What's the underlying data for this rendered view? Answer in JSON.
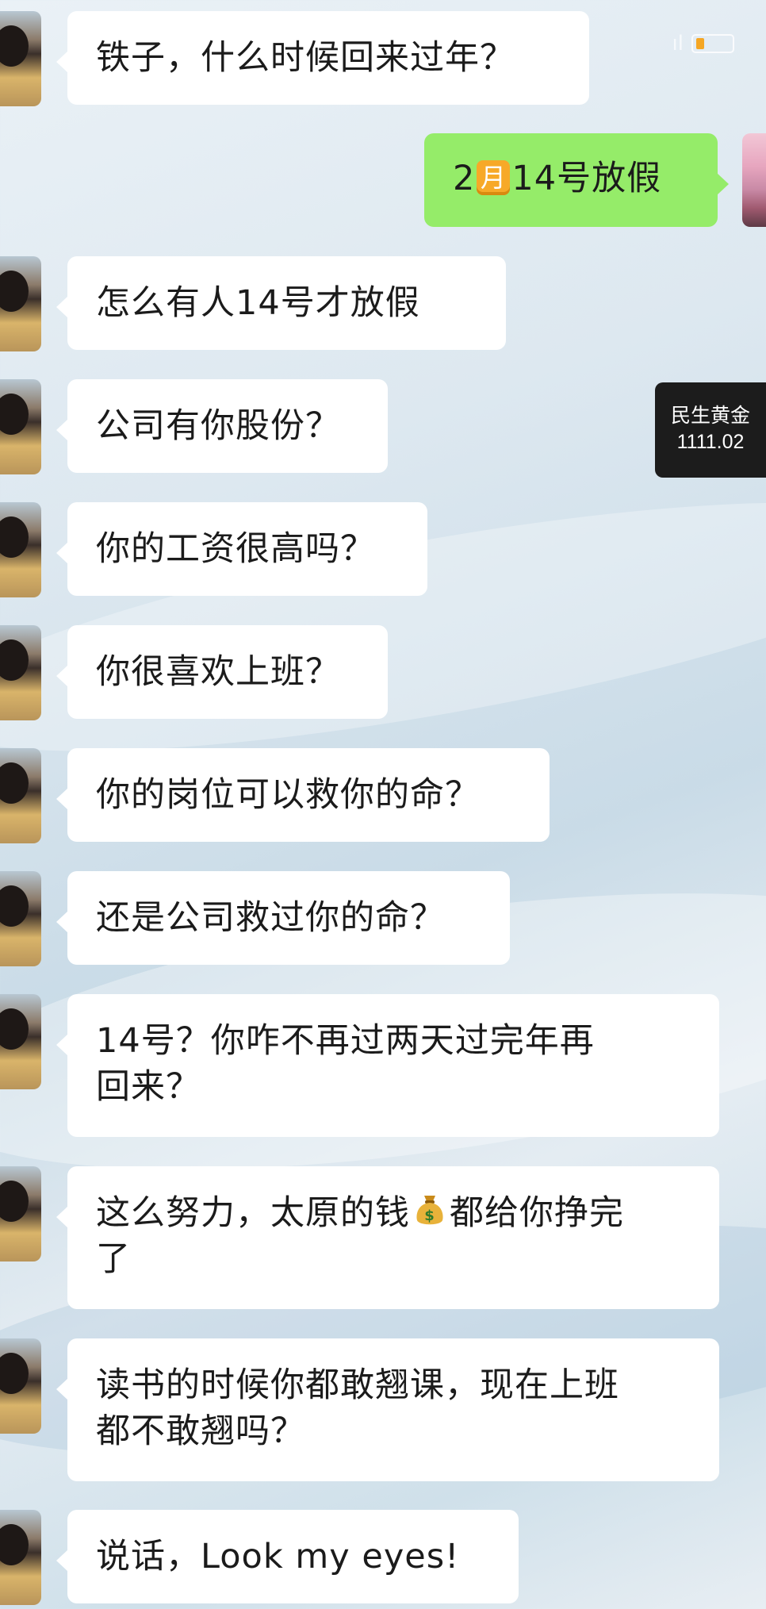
{
  "status_bar": {
    "ghost_text": "ıl",
    "battery_color": "#f5a623"
  },
  "messages": [
    {
      "sender": "friend",
      "text": "铁子，什么时候回来过年？"
    },
    {
      "sender": "self",
      "text_prefix": "2",
      "month_badge": "月",
      "text_suffix": "14号放假"
    },
    {
      "sender": "friend",
      "text": "怎么有人14号才放假"
    },
    {
      "sender": "friend",
      "text": "公司有你股份？"
    },
    {
      "sender": "friend",
      "text": "你的工资很高吗？"
    },
    {
      "sender": "friend",
      "text": "你很喜欢上班？"
    },
    {
      "sender": "friend",
      "text": "你的岗位可以救你的命？"
    },
    {
      "sender": "friend",
      "text": "还是公司救过你的命？"
    },
    {
      "sender": "friend",
      "text_line1": "14号？你咋不再过两天过完年再",
      "text_line2": "回来？"
    },
    {
      "sender": "friend",
      "text_before_icon": "这么努力，太原的钱",
      "icon": "money-bag-icon",
      "text_after_icon": "都给你挣完",
      "text_line2": "了"
    },
    {
      "sender": "friend",
      "text_line1": "读书的时候你都敢翘课，现在上班",
      "text_line2": "都不敢翘吗？"
    },
    {
      "sender": "friend",
      "text": "说话，Look my eyes!"
    }
  ],
  "ticker": {
    "name": "民生黄金",
    "price": "1111.02"
  },
  "colors": {
    "self_bubble": "#95ec69",
    "friend_bubble": "#ffffff",
    "ticker_bg": "#1c1c1c"
  }
}
